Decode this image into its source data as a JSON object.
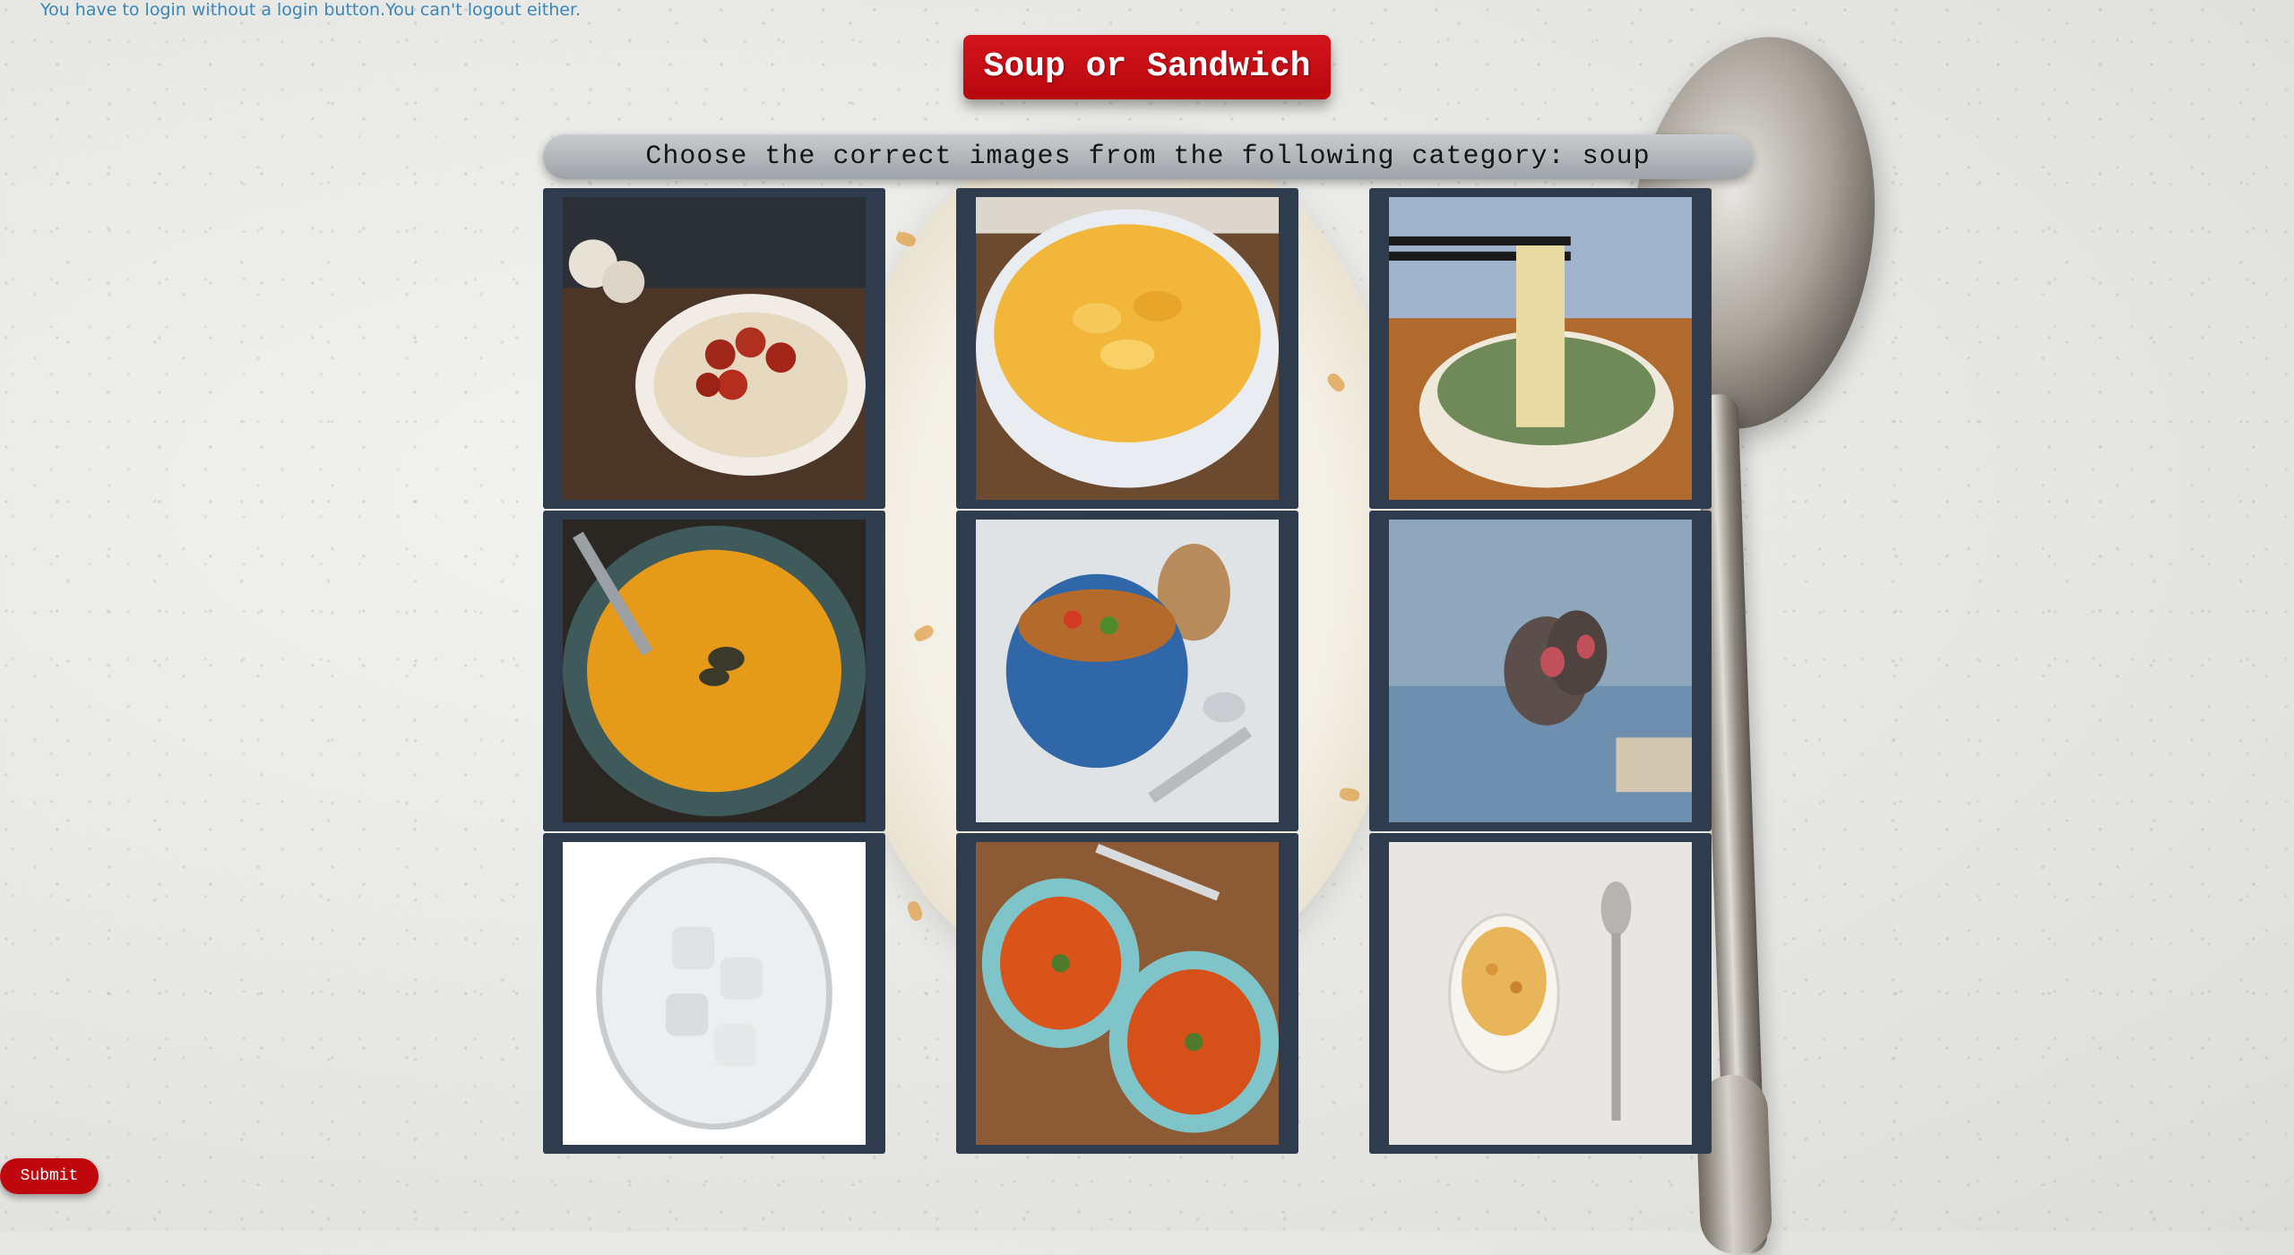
{
  "notice": "You have to login without a login button.You can't logout either.",
  "title": "Soup or Sandwich",
  "instruction": "Choose the correct images from the following category: soup",
  "submit_label": "Submit",
  "tiles": [
    {
      "subject": "hummus bowl with roasted tomatoes"
    },
    {
      "subject": "macaroni and cheese"
    },
    {
      "subject": "noodle soup with chopsticks"
    },
    {
      "subject": "pumpkin soup with seeds"
    },
    {
      "subject": "minestrone pot with bread"
    },
    {
      "subject": "monkeys in hot spring"
    },
    {
      "subject": "glass of ice water"
    },
    {
      "subject": "two bowls of tomato soup"
    },
    {
      "subject": "cereal bowl with spoon"
    }
  ]
}
